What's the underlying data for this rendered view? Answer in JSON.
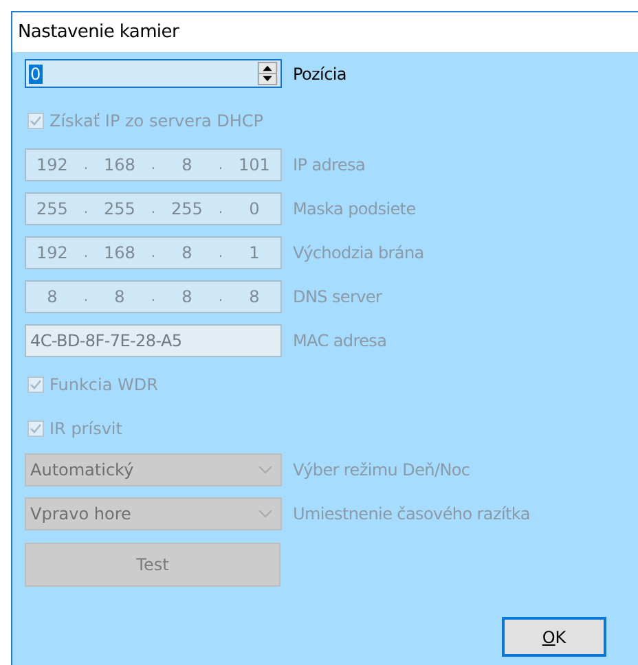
{
  "window": {
    "title": "Nastavenie kamier"
  },
  "rows": [
    {
      "kind": "spin",
      "value": "0",
      "caption": "Pozícia",
      "disabled": false
    },
    {
      "kind": "check",
      "label": "Získať IP zo servera DHCP",
      "checked": true,
      "disabled": true
    },
    {
      "kind": "ip",
      "octets": [
        "192",
        ".",
        "168",
        ".",
        "8",
        ".",
        "101"
      ],
      "caption": "IP adresa",
      "disabled": true
    },
    {
      "kind": "ip",
      "octets": [
        "255",
        ".",
        "255",
        ".",
        "255",
        ".",
        "0"
      ],
      "caption": "Maska podsiete",
      "disabled": true
    },
    {
      "kind": "ip",
      "octets": [
        "192",
        ".",
        "168",
        ".",
        "8",
        ".",
        "1"
      ],
      "caption": "Východzia brána",
      "disabled": true
    },
    {
      "kind": "ip",
      "octets": [
        "8",
        ".",
        "8",
        ".",
        "8",
        ".",
        "8"
      ],
      "caption": "DNS server",
      "disabled": true
    },
    {
      "kind": "text",
      "value": "4C-BD-8F-7E-28-A5",
      "caption": "MAC adresa",
      "disabled": true
    },
    {
      "kind": "check",
      "label": "Funkcia WDR",
      "checked": true,
      "disabled": true
    },
    {
      "kind": "check",
      "label": "IR prísvit",
      "checked": true,
      "disabled": true
    },
    {
      "kind": "combo",
      "value": "Automatický",
      "caption": "Výber režimu Deň/Noc",
      "disabled": true
    },
    {
      "kind": "combo",
      "value": "Vpravo hore",
      "caption": "Umiestnenie časového razítka",
      "disabled": true
    },
    {
      "kind": "button",
      "label": "Test",
      "disabled": true
    }
  ],
  "ok_button": {
    "label": "OK"
  }
}
